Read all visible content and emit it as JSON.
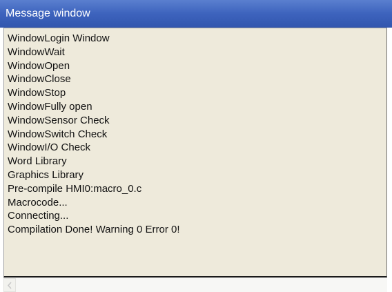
{
  "window": {
    "title": "Message window",
    "title_bar_color": "#3d63bd",
    "pane_background": "#eeeadb"
  },
  "messages": [
    "WindowLogin Window",
    "WindowWait",
    "WindowOpen",
    "WindowClose",
    "WindowStop",
    "WindowFully open",
    "WindowSensor Check",
    "WindowSwitch Check",
    "WindowI/O Check",
    "Word Library",
    "Graphics Library",
    "Pre-compile HMI0:macro_0.c",
    "Macrocode...",
    "Connecting...",
    "Compilation Done! Warning 0 Error 0!"
  ],
  "scrollbar": {
    "left_arrow_icon": "chevron-left-icon"
  }
}
